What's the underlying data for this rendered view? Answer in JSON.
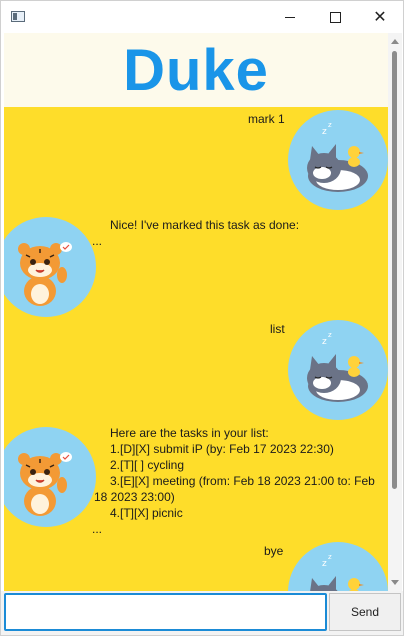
{
  "window": {
    "app_icon": "window-app-icon",
    "controls": [
      "minimize-icon",
      "maximize-icon",
      "close-icon"
    ]
  },
  "header": {
    "title": "Duke"
  },
  "dialog": [
    {
      "speaker": "user",
      "text": "mark 1",
      "avatar": "sleeping-cat-avatar"
    },
    {
      "speaker": "duke",
      "text": "Nice! I've marked this task as done:",
      "extra": "...",
      "avatar": "tiger-avatar"
    },
    {
      "speaker": "user",
      "text": "list",
      "avatar": "sleeping-cat-avatar"
    },
    {
      "speaker": "duke",
      "lines": [
        "Here are the tasks in your list:",
        "1.[D][X] submit iP (by: Feb 17 2023 22:30)",
        "2.[T][ ] cycling",
        "3.[E][X] meeting (from: Feb 18 2023 21:00 to: Feb",
        "18 2023 23:00)",
        "4.[T][X] picnic"
      ],
      "extra": "...",
      "avatar": "tiger-avatar"
    },
    {
      "speaker": "user",
      "text": "bye",
      "avatar": "sleeping-cat-avatar"
    }
  ],
  "input": {
    "value": "",
    "placeholder": ""
  },
  "send_label": "Send",
  "colors": {
    "header_bg": "#fdfaeb",
    "title": "#1a95e8",
    "chat_bg": "#fedd2a",
    "avatar_bg": "#8fd3f2",
    "input_border": "#1b8bd6"
  }
}
